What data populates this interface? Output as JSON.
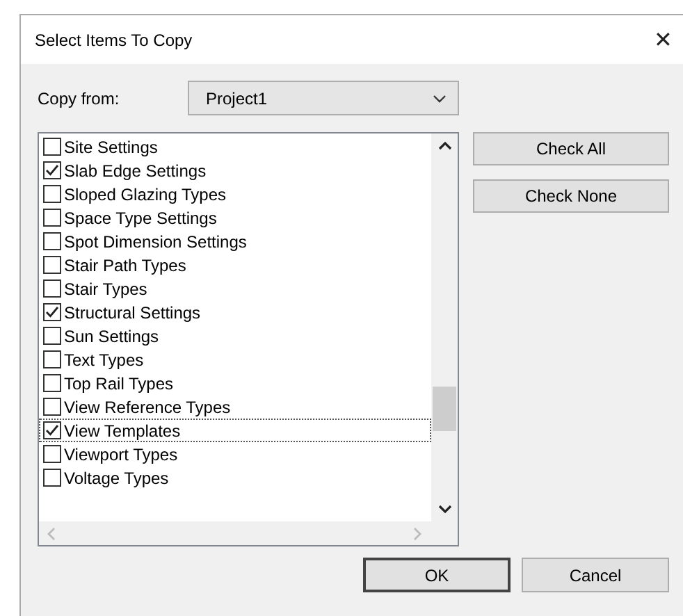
{
  "window": {
    "title": "Select Items To Copy",
    "close": "✕"
  },
  "copy_from": {
    "label": "Copy from:",
    "value": "Project1"
  },
  "items": [
    {
      "label": "Site Settings",
      "checked": false,
      "focused": false
    },
    {
      "label": "Slab Edge Settings",
      "checked": true,
      "focused": false
    },
    {
      "label": "Sloped Glazing Types",
      "checked": false,
      "focused": false
    },
    {
      "label": "Space Type Settings",
      "checked": false,
      "focused": false
    },
    {
      "label": "Spot Dimension Settings",
      "checked": false,
      "focused": false
    },
    {
      "label": "Stair Path Types",
      "checked": false,
      "focused": false
    },
    {
      "label": "Stair Types",
      "checked": false,
      "focused": false
    },
    {
      "label": "Structural Settings",
      "checked": true,
      "focused": false
    },
    {
      "label": "Sun Settings",
      "checked": false,
      "focused": false
    },
    {
      "label": "Text Types",
      "checked": false,
      "focused": false
    },
    {
      "label": "Top Rail Types",
      "checked": false,
      "focused": false
    },
    {
      "label": "View Reference Types",
      "checked": false,
      "focused": false
    },
    {
      "label": "View Templates",
      "checked": true,
      "focused": true
    },
    {
      "label": "Viewport Types",
      "checked": false,
      "focused": false
    },
    {
      "label": "Voltage Types",
      "checked": false,
      "focused": false
    }
  ],
  "side_buttons": [
    "Check All",
    "Check None"
  ],
  "footer_buttons": [
    {
      "label": "OK",
      "default": true
    },
    {
      "label": "Cancel",
      "default": false
    }
  ]
}
